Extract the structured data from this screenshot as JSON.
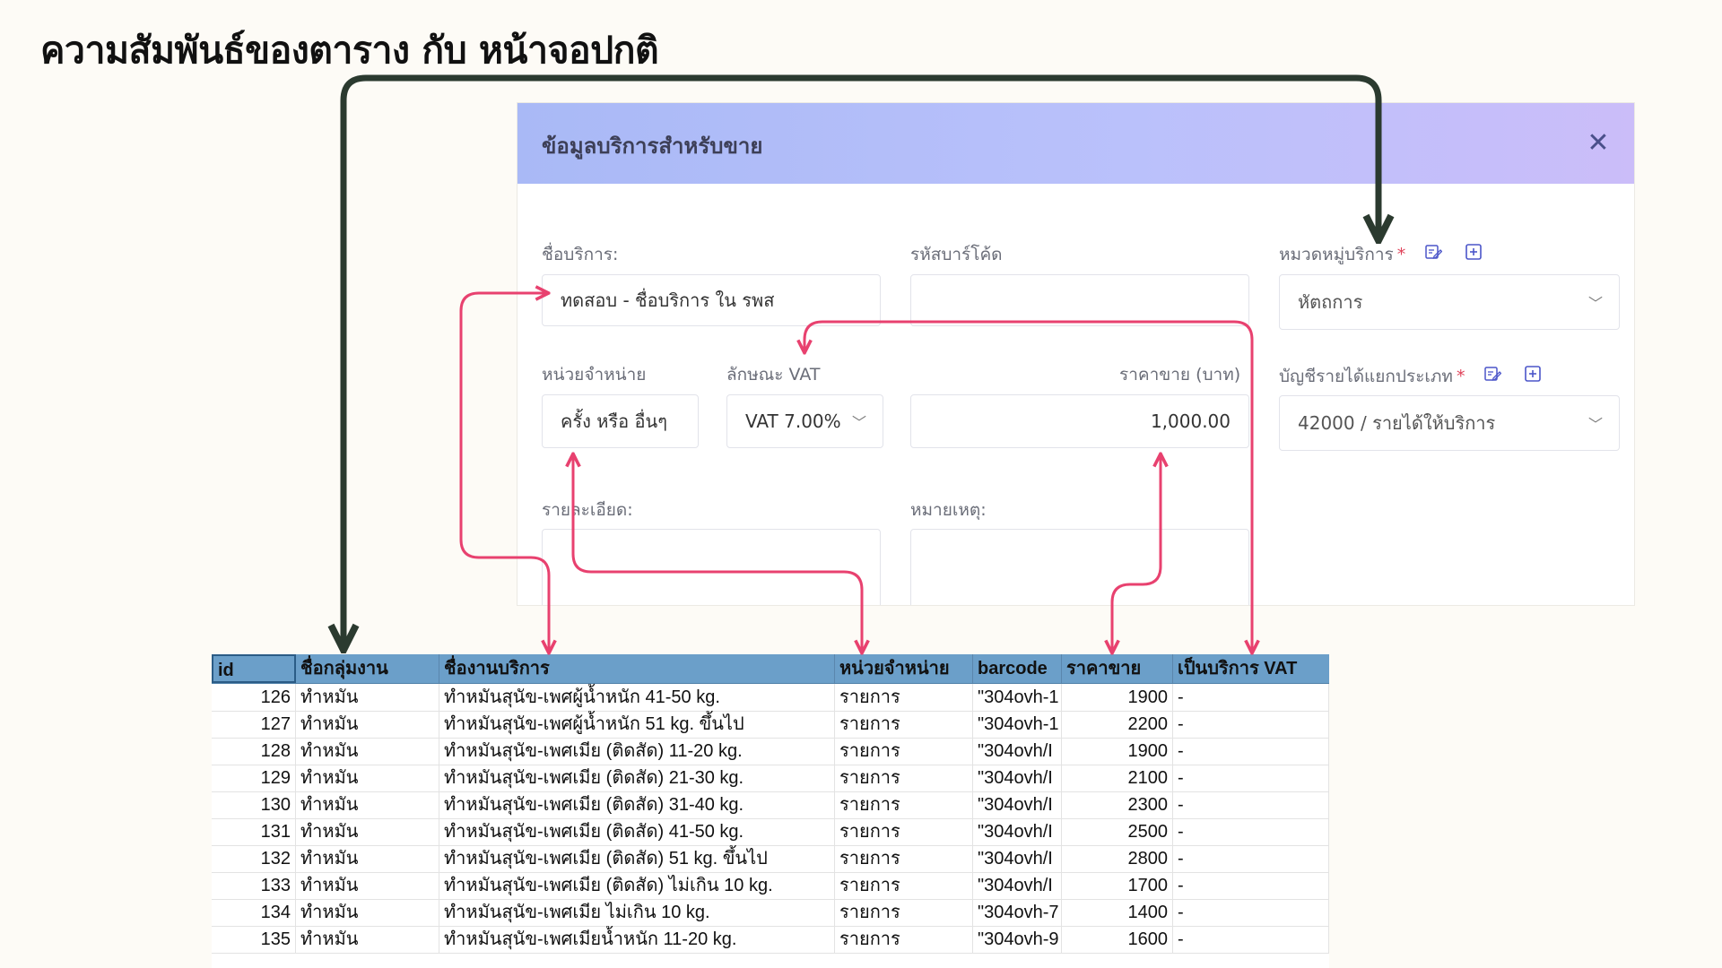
{
  "page_title": "ความสัมพันธ์ของตาราง กับ หน้าจอปกติ",
  "dialog": {
    "title": "ข้อมูลบริการสำหรับขาย",
    "close_icon": "close-icon",
    "fields": {
      "service_name": {
        "label": "ชื่อบริการ:",
        "value": "ทดสอบ - ชื่อบริการ ใน รพส"
      },
      "barcode": {
        "label": "รหัสบาร์โค้ด",
        "value": ""
      },
      "category": {
        "label": "หมวดหมู่บริการ",
        "required": "*",
        "value": "หัตถการ"
      },
      "unit": {
        "label": "หน่วยจำหน่าย",
        "value": "ครั้ง หรือ อื่นๆ"
      },
      "vat": {
        "label": "ลักษณะ VAT",
        "value": "VAT 7.00%"
      },
      "price": {
        "label": "ราคาขาย (บาท)",
        "value": "1,000.00"
      },
      "income_account": {
        "label": "บัญชีรายได้แยกประเภท",
        "required": "*",
        "value": "42000 / รายได้ให้บริการ"
      },
      "details": {
        "label": "รายละเอียด:",
        "value": ""
      },
      "remark": {
        "label": "หมายเหตุ:",
        "value": ""
      }
    }
  },
  "sheet": {
    "columns": [
      "id",
      "ชื่อกลุ่มงาน",
      "ชื่องานบริการ",
      "หน่วยจำหน่าย",
      "barcode",
      "ราคาขาย",
      "เป็นบริการ VAT"
    ],
    "rows": [
      [
        "126",
        "ทำหมัน",
        "ทำหมันสุนัข-เพศผู้น้ำหนัก 41-50 kg.",
        "รายการ",
        "\"304ovh-1",
        "1900",
        "-"
      ],
      [
        "127",
        "ทำหมัน",
        "ทำหมันสุนัข-เพศผู้น้ำหนัก 51 kg. ขึ้นไป",
        "รายการ",
        "\"304ovh-1",
        "2200",
        "-"
      ],
      [
        "128",
        "ทำหมัน",
        "ทำหมันสุนัข-เพศเมีย (ติดสัด) 11-20 kg.",
        "รายการ",
        "\"304ovh/I",
        "1900",
        "-"
      ],
      [
        "129",
        "ทำหมัน",
        "ทำหมันสุนัข-เพศเมีย (ติดสัด) 21-30 kg.",
        "รายการ",
        "\"304ovh/I",
        "2100",
        "-"
      ],
      [
        "130",
        "ทำหมัน",
        "ทำหมันสุนัข-เพศเมีย (ติดสัด) 31-40 kg.",
        "รายการ",
        "\"304ovh/I",
        "2300",
        "-"
      ],
      [
        "131",
        "ทำหมัน",
        "ทำหมันสุนัข-เพศเมีย (ติดสัด) 41-50 kg.",
        "รายการ",
        "\"304ovh/I",
        "2500",
        "-"
      ],
      [
        "132",
        "ทำหมัน",
        "ทำหมันสุนัข-เพศเมีย (ติดสัด) 51 kg. ขึ้นไป",
        "รายการ",
        "\"304ovh/I",
        "2800",
        "-"
      ],
      [
        "133",
        "ทำหมัน",
        "ทำหมันสุนัข-เพศเมีย (ติดสัด) ไม่เกิน 10 kg.",
        "รายการ",
        "\"304ovh/I",
        "1700",
        "-"
      ],
      [
        "134",
        "ทำหมัน",
        "ทำหมันสุนัข-เพศเมีย ไม่เกิน 10 kg.",
        "รายการ",
        "\"304ovh-7",
        "1400",
        "-"
      ],
      [
        "135",
        "ทำหมัน",
        "ทำหมันสุนัข-เพศเมียน้ำหนัก 11-20 kg.",
        "รายการ",
        "\"304ovh-9",
        "1600",
        "-"
      ]
    ]
  },
  "colors": {
    "dark_arrow": "#2b3a2f",
    "pink_arrow": "#e8416f",
    "header_blue": "#6b9fc9"
  }
}
